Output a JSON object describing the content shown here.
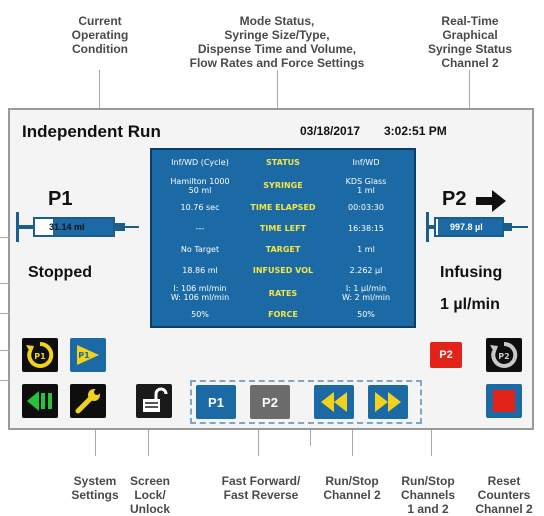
{
  "callouts": {
    "top_left": "Current\nOperating\nCondition",
    "top_center": "Mode Status,\nSyringe Size/Type,\nDispense Time and Volume,\nFlow Rates and Force Settings",
    "top_right": "Real-Time\nGraphical\nSyringe Status\nChannel 2",
    "bottom_system": "System\nSettings",
    "bottom_lock": "Screen\nLock/\nUnlock",
    "bottom_ff": "Fast Forward/\nFast Reverse",
    "bottom_run2": "Run/Stop\nChannel 2",
    "bottom_run12": "Run/Stop\nChannels\n1 and 2",
    "bottom_reset": "Reset\nCounters\nChannel 2"
  },
  "screen": {
    "title": "Independent Run",
    "date": "03/18/2017",
    "time": "3:02:51 PM"
  },
  "channel1": {
    "label": "P1",
    "syringe_value": "31.14 ml",
    "status": "Stopped"
  },
  "channel2": {
    "label": "P2",
    "syringe_value": "997.8 µl",
    "status": "Infusing",
    "rate": "1 µl/min",
    "arrow": "right-arrow-icon"
  },
  "status_panel": {
    "rows": [
      {
        "left": "Inf/WD (Cycle)",
        "label": "STATUS",
        "right": "Inf/WD"
      },
      {
        "left": "Hamilton 1000\n50 ml",
        "label": "SYRINGE",
        "right": "KDS Glass\n1 ml"
      },
      {
        "left": "10.76 sec",
        "label": "TIME ELAPSED",
        "right": "00:03:30"
      },
      {
        "left": "---",
        "label": "TIME LEFT",
        "right": "16:38:15"
      },
      {
        "left": "No Target",
        "label": "TARGET",
        "right": "1 ml"
      },
      {
        "left": "18.86 ml",
        "label": "INFUSED VOL",
        "right": "2.262 µl"
      },
      {
        "left": "I: 106 ml/min\nW: 106 ml/min",
        "label": "RATES",
        "right": "I: 1 µl/min\nW: 2 ml/min"
      },
      {
        "left": "50%",
        "label": "FORCE",
        "right": "50%"
      }
    ]
  },
  "buttons": {
    "p1": "P1",
    "p2": "P2",
    "p2_red": "P2"
  },
  "colors": {
    "panel_blue": "#1b6aa5",
    "panel_label": "#f4e64a",
    "accent_red": "#e2231a",
    "yellow": "#f2d21c",
    "green": "#27c33b"
  }
}
